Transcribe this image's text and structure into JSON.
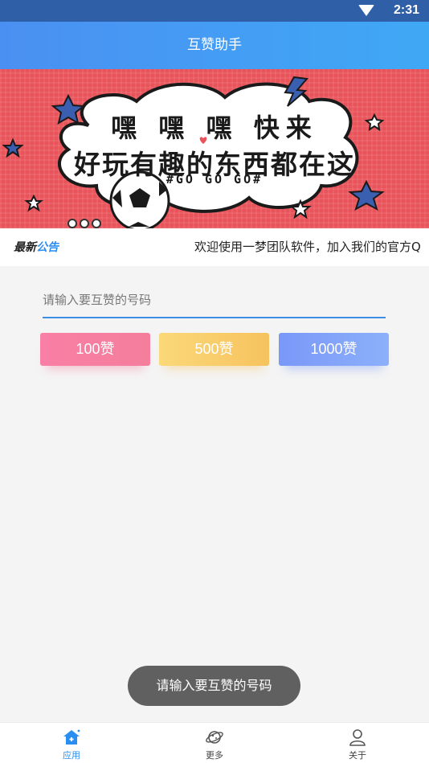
{
  "status_bar": {
    "time": "2:31",
    "icons": [
      "wifi-icon"
    ]
  },
  "app_bar": {
    "title": "互赞助手"
  },
  "banner": {
    "line1": "嘿 嘿 嘿 快来",
    "line2": "好玩有趣的东西都在这",
    "line3": "#GO GO GO#",
    "pager_dots": 3,
    "colors": {
      "background": "#e8545a",
      "cloud": "#ffffff",
      "star": "#3a5fb0"
    }
  },
  "notice": {
    "tag_part1": "最新",
    "tag_part2": "公告",
    "message": "欢迎使用一梦团队软件，加入我们的官方Q"
  },
  "form": {
    "number_input": {
      "placeholder": "请输入要互赞的号码",
      "value": ""
    },
    "buttons": [
      {
        "label": "100赞",
        "color": "#f77fa0"
      },
      {
        "label": "500赞",
        "color": "#f6c35e"
      },
      {
        "label": "1000赞",
        "color": "#7a98f8"
      }
    ]
  },
  "toast": {
    "message": "请输入要互赞的号码"
  },
  "tab_bar": {
    "tabs": [
      {
        "label": "应用",
        "icon": "home-icon",
        "active": true
      },
      {
        "label": "更多",
        "icon": "planet-icon",
        "active": false
      },
      {
        "label": "关于",
        "icon": "user-icon",
        "active": false
      }
    ],
    "active_color": "#2a8ef0"
  }
}
